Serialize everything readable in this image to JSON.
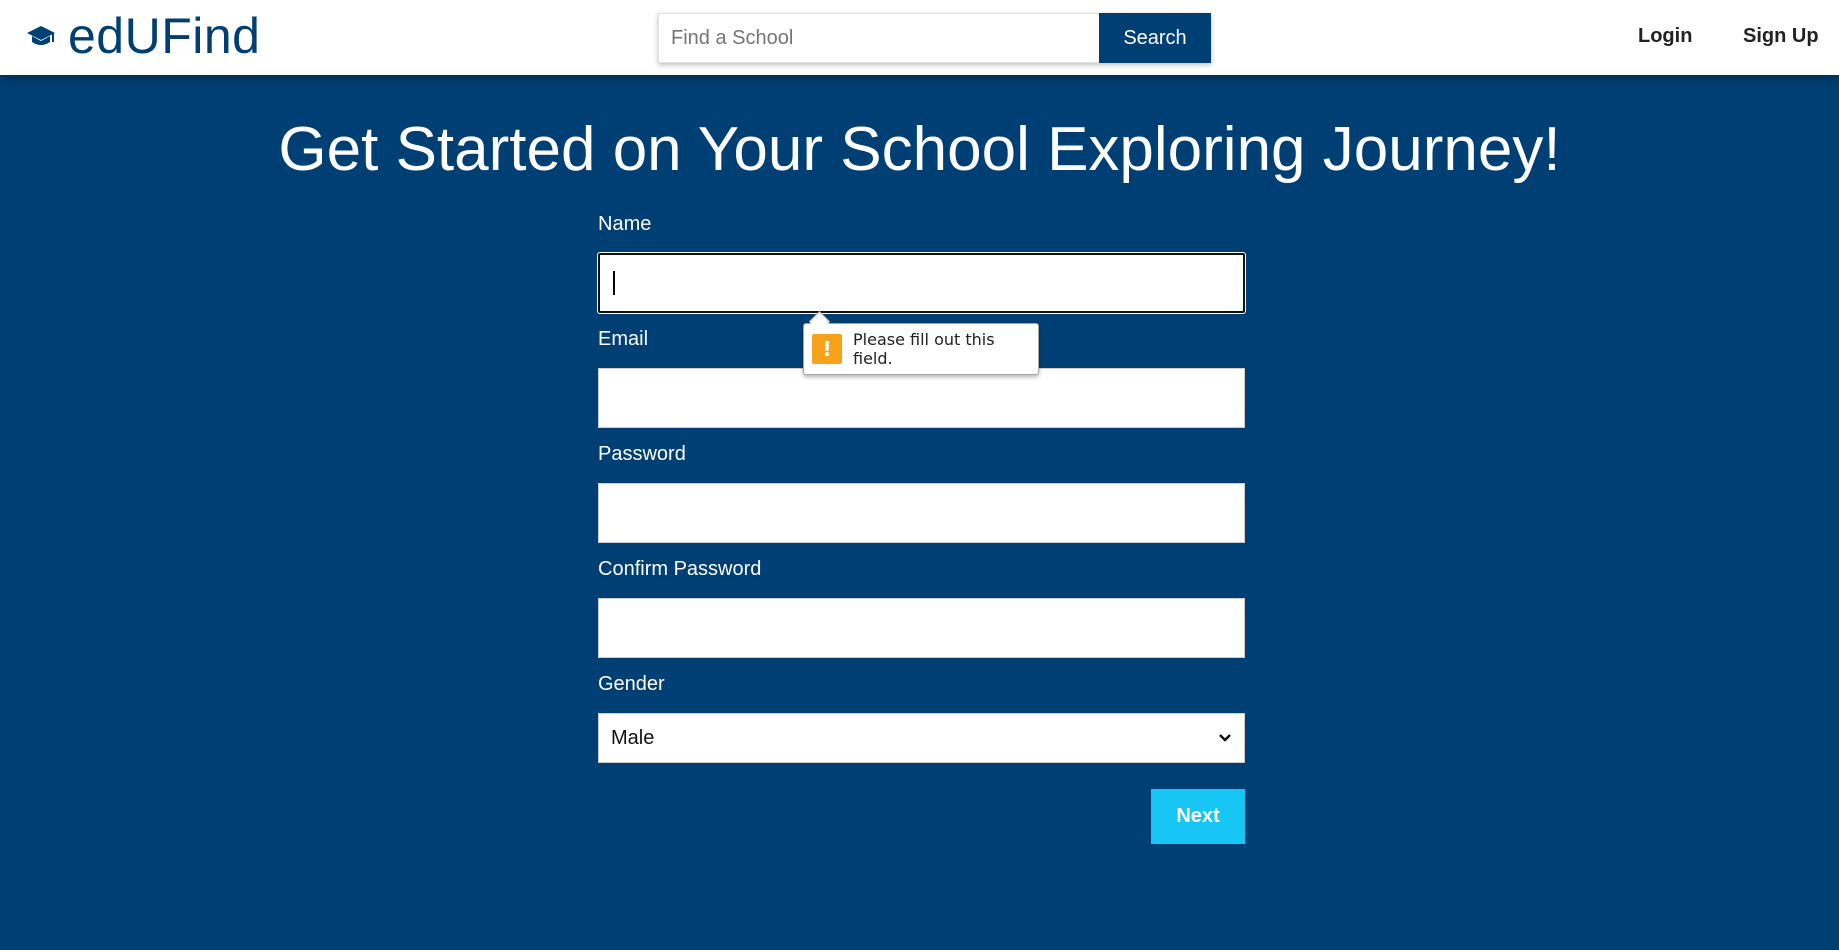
{
  "header": {
    "brand_name": "edUFind",
    "brand_icon": "graduation-cap-icon",
    "search_placeholder": "Find a School",
    "search_value": "",
    "search_button": "Search",
    "login_label": "Login",
    "signup_label": "Sign Up"
  },
  "main": {
    "title": "Get Started on Your School Exploring Journey!",
    "fields": {
      "name_label": "Name",
      "name_value": "",
      "email_label": "Email",
      "email_value": "",
      "password_label": "Password",
      "password_value": "",
      "confirm_password_label": "Confirm Password",
      "confirm_password_value": "",
      "gender_label": "Gender",
      "gender_selected": "Male"
    },
    "next_button": "Next"
  },
  "validation_tooltip": {
    "icon": "warning-icon",
    "message": "Please fill out this field."
  },
  "colors": {
    "brand_navy": "#003f74",
    "next_button": "#17c6f4",
    "warning": "#f7a21b",
    "header_bg": "#ffffff"
  }
}
